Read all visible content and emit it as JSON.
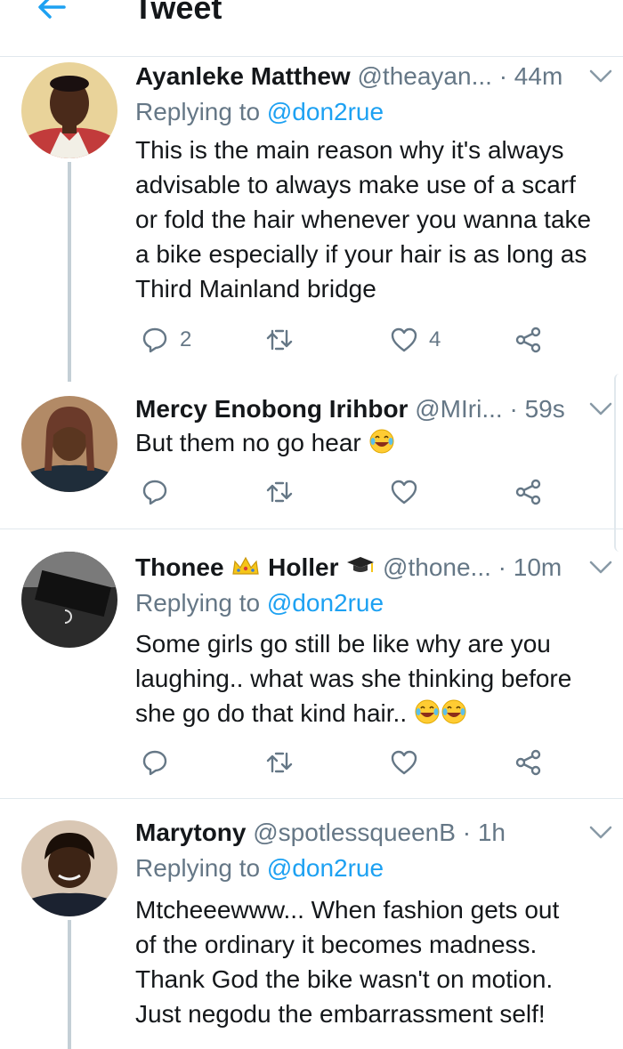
{
  "header": {
    "title": "Tweet",
    "back_icon": "arrow-left-icon"
  },
  "colors": {
    "link": "#1da1f2",
    "muted": "#657786",
    "divider": "#e1e8ed",
    "thread_line": "#c4cfd6"
  },
  "tweets": [
    {
      "name": "Ayanleke Matthew",
      "handle": "@theayan...",
      "sep": "·",
      "time": "44m",
      "replying_prefix": "Replying to",
      "replying_to": "@don2rue",
      "lines": [
        "This is the main reason why it's always",
        "advisable to always make use of a scarf",
        "or fold the hair whenever you wanna take",
        "a bike especially if your hair is as long as",
        "Third Mainland bridge"
      ],
      "reply_count": "2",
      "retweet_count": "",
      "like_count": "4"
    },
    {
      "name": "Mercy Enobong Irihbor",
      "handle": "@MIri...",
      "sep": "·",
      "time": "59s",
      "lines": [
        "But them no go hear"
      ],
      "emoji": "😂",
      "reply_count": "",
      "retweet_count": "",
      "like_count": ""
    },
    {
      "name_part1": "Thonee",
      "emoji_crown": "👑",
      "name_part2": "Holler",
      "emoji_cap": "🎓",
      "handle": "@thone...",
      "sep": "·",
      "time": "10m",
      "replying_prefix": "Replying to",
      "replying_to": "@don2rue",
      "lines": [
        "Some girls go still be like why are you",
        "laughing.. what was she thinking before",
        "she go do that kind hair.."
      ],
      "emoji": "😂😂",
      "reply_count": "",
      "retweet_count": "",
      "like_count": ""
    },
    {
      "name": "Marytony",
      "handle": "@spotlessqueenB",
      "sep": "·",
      "time": "1h",
      "replying_prefix": "Replying to",
      "replying_to": "@don2rue",
      "lines": [
        "Mtcheeewww... When fashion gets out",
        "of the ordinary it becomes madness.",
        "Thank God the bike wasn't on motion.",
        "Just negodu the embarrassment self!"
      ]
    }
  ]
}
